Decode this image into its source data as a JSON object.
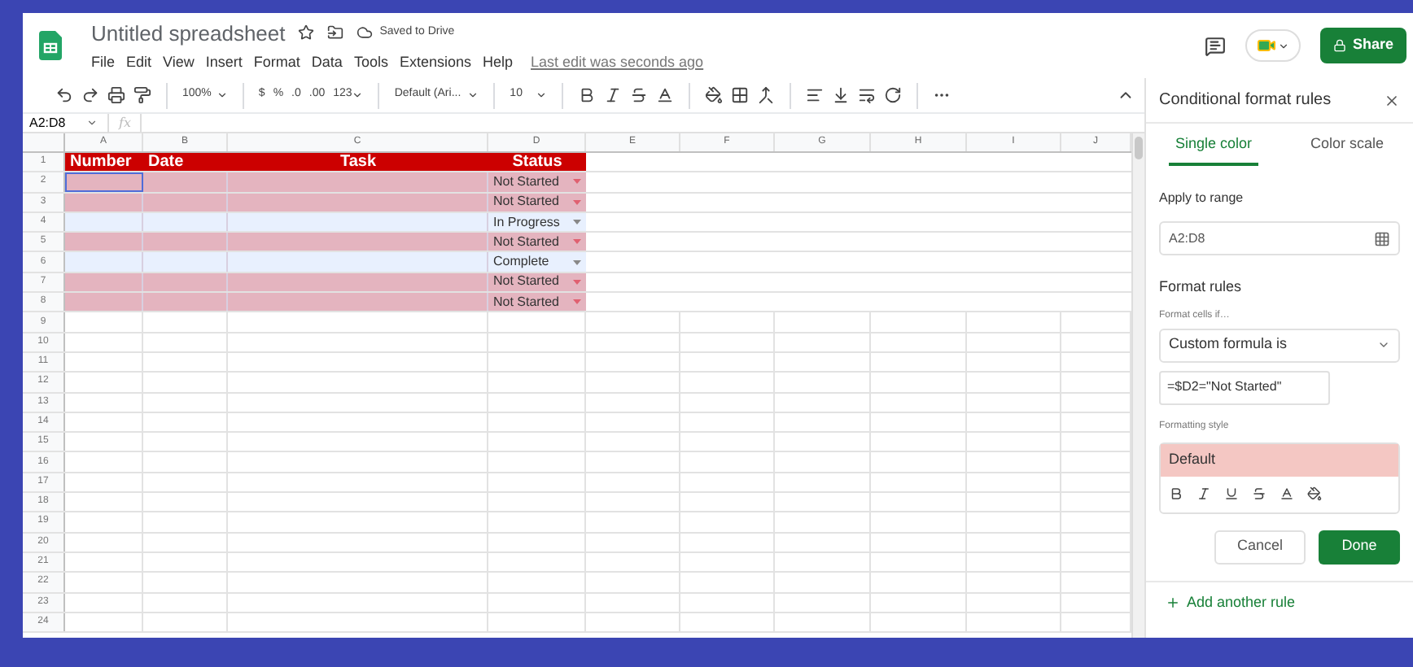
{
  "title": "Untitled spreadsheet",
  "saved_status": "Saved to Drive",
  "menu": [
    "File",
    "Edit",
    "View",
    "Insert",
    "Format",
    "Data",
    "Tools",
    "Extensions",
    "Help"
  ],
  "last_edit": "Last edit was seconds ago",
  "share_button": "Share",
  "toolbar": {
    "zoom": "100%",
    "currency": "$",
    "percent": "%",
    "decrease_decimal": ".0",
    "increase_decimal": ".00",
    "number_format": "123",
    "font": "Default (Ari...",
    "font_size": "10"
  },
  "name_box": "A2:D8",
  "formula_label": "fx",
  "columns": [
    "A",
    "B",
    "C",
    "D",
    "E",
    "F",
    "G",
    "H",
    "I",
    "J"
  ],
  "header_row": {
    "number": "1",
    "cells": [
      "Number",
      "Date",
      "Task",
      "Status"
    ]
  },
  "rows": [
    {
      "number": "2",
      "status": "Not Started",
      "highlighted": true
    },
    {
      "number": "3",
      "status": "Not Started",
      "highlighted": true
    },
    {
      "number": "4",
      "status": "In Progress",
      "highlighted": false
    },
    {
      "number": "5",
      "status": "Not Started",
      "highlighted": true
    },
    {
      "number": "6",
      "status": "Complete",
      "highlighted": false
    },
    {
      "number": "7",
      "status": "Not Started",
      "highlighted": true
    },
    {
      "number": "8",
      "status": "Not Started",
      "highlighted": true
    }
  ],
  "empty_rows": [
    "9",
    "10",
    "11",
    "12",
    "13",
    "14",
    "15",
    "16",
    "17",
    "18",
    "19",
    "20",
    "21",
    "22",
    "23",
    "24"
  ],
  "panel": {
    "title": "Conditional format rules",
    "tabs": [
      {
        "label": "Single color",
        "selected": true
      },
      {
        "label": "Color scale",
        "selected": false
      }
    ],
    "apply_label": "Apply to range",
    "range": "A2:D8",
    "rules_heading": "Format rules",
    "condition_label": "Format cells if…",
    "condition": "Custom formula is",
    "formula": "=$D2=\"Not Started\"",
    "style_label": "Formatting style",
    "style_preview": "Default",
    "cancel": "Cancel",
    "done": "Done",
    "add_rule": "Add another rule"
  }
}
